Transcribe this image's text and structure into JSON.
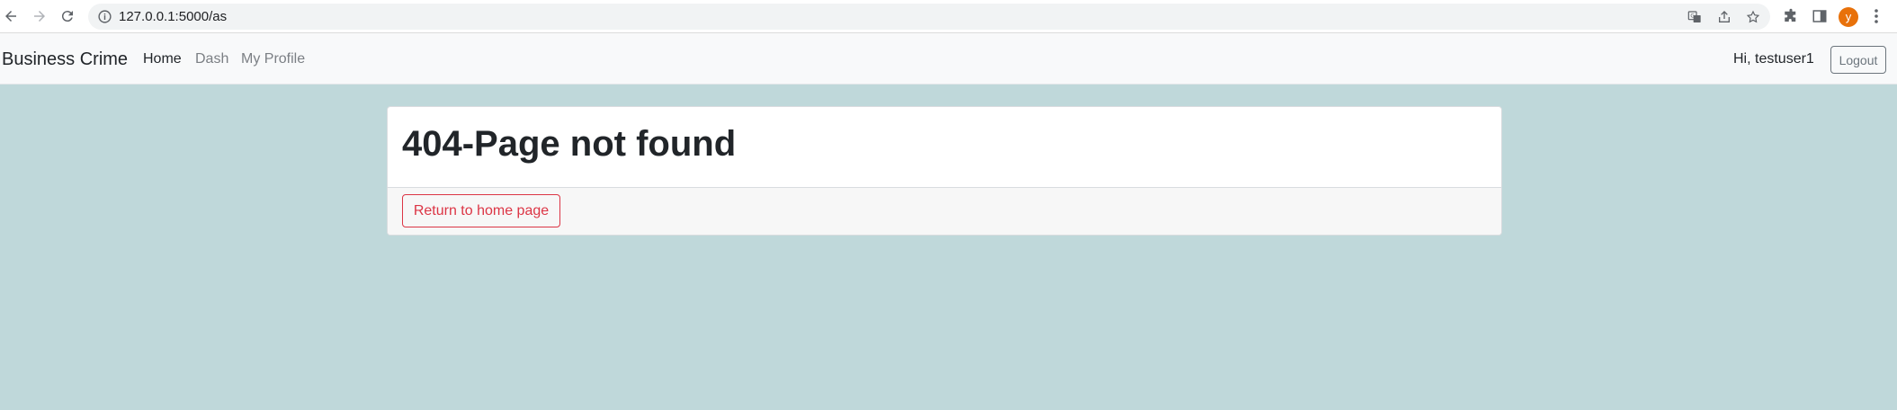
{
  "browser": {
    "url": "127.0.0.1:5000/as",
    "profile_initial": "y",
    "icons": [
      "back-icon",
      "forward-icon",
      "reload-icon",
      "site-info-icon",
      "translate-icon",
      "share-icon",
      "bookmark-star-icon",
      "extensions-icon",
      "side-panel-icon",
      "profile-avatar",
      "menu-kebab-icon"
    ]
  },
  "navbar": {
    "brand": "Business Crime",
    "links": [
      {
        "label": "Home",
        "active": true
      },
      {
        "label": "Dash",
        "active": false
      },
      {
        "label": "My Profile",
        "active": false
      }
    ],
    "greeting": "Hi, testuser1",
    "logout_label": "Logout"
  },
  "card": {
    "title": "404-Page not found",
    "return_button_label": "Return to home page"
  },
  "colors": {
    "page_background": "#bfd8da",
    "navbar_background": "#f8f9fa",
    "danger": "#dc3545",
    "avatar": "#e8710a"
  }
}
